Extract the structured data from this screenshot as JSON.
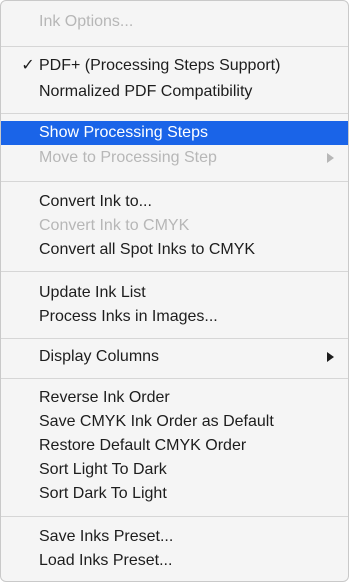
{
  "menu": {
    "items": [
      {
        "label": "Ink Options...",
        "disabled": true
      },
      {
        "label": "PDF+ (Processing Steps Support)",
        "checked": true,
        "check_glyph": "✓"
      },
      {
        "label": "Normalized PDF Compatibility"
      },
      {
        "label": "Show Processing Steps",
        "highlighted": true
      },
      {
        "label": "Move to Processing Step",
        "disabled": true,
        "submenu": true
      },
      {
        "label": "Convert Ink to..."
      },
      {
        "label": "Convert Ink to CMYK",
        "disabled": true
      },
      {
        "label": "Convert all Spot Inks to CMYK"
      },
      {
        "label": "Update Ink List"
      },
      {
        "label": "Process Inks in Images..."
      },
      {
        "label": "Display Columns",
        "submenu": true
      },
      {
        "label": "Reverse Ink Order"
      },
      {
        "label": "Save CMYK Ink Order as Default"
      },
      {
        "label": "Restore Default CMYK Order"
      },
      {
        "label": "Sort Light To Dark"
      },
      {
        "label": "Sort Dark To Light"
      },
      {
        "label": "Save Inks Preset..."
      },
      {
        "label": "Load Inks Preset..."
      }
    ]
  },
  "colors": {
    "highlight": "#1a64e8",
    "disabled_text": "#b7b7b7",
    "text": "#1d1d1d",
    "background": "#f5f5f5"
  }
}
